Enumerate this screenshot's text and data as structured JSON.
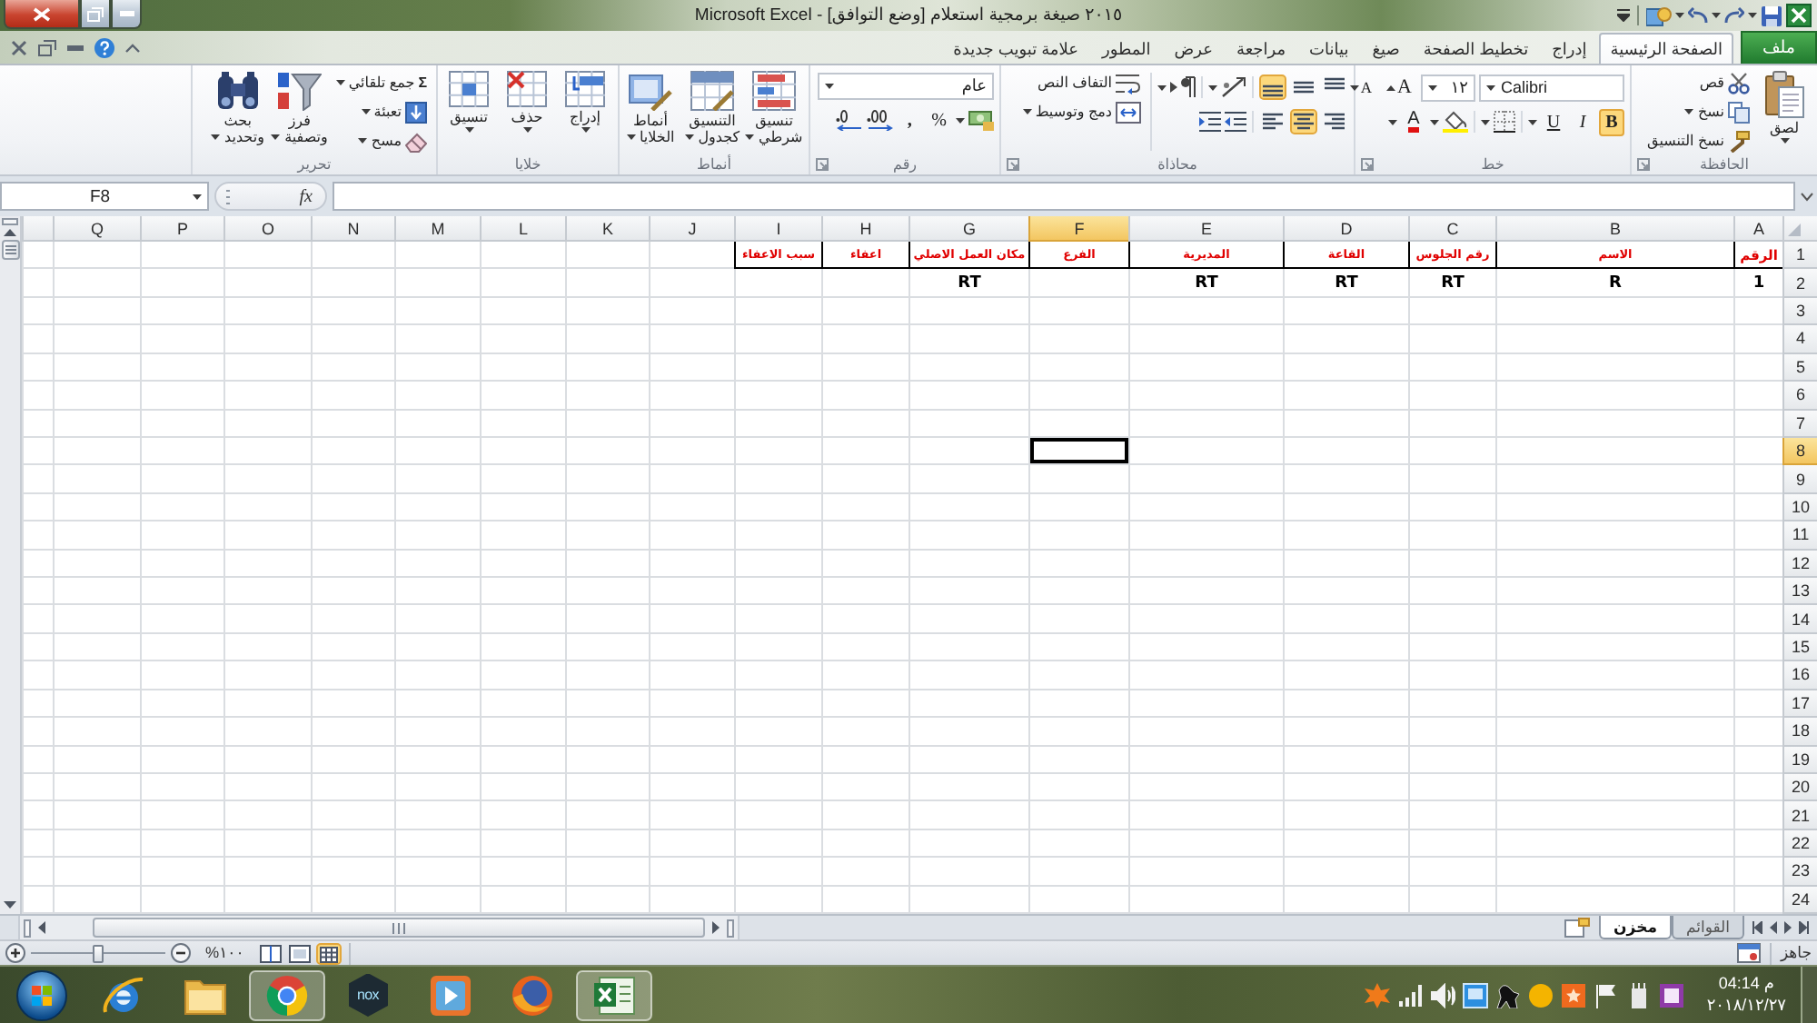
{
  "window": {
    "title": "٢٠١٥ صيغة برمجية استعلام [وضع التوافق] - Microsoft Excel"
  },
  "ribbon_tabs": [
    {
      "label": "ملف",
      "kind": "file",
      "selected": false
    },
    {
      "label": "الصفحة الرئيسية",
      "kind": "tab",
      "selected": true
    },
    {
      "label": "إدراج",
      "kind": "tab",
      "selected": false
    },
    {
      "label": "تخطيط الصفحة",
      "kind": "tab",
      "selected": false
    },
    {
      "label": "صيغ",
      "kind": "tab",
      "selected": false
    },
    {
      "label": "بيانات",
      "kind": "tab",
      "selected": false
    },
    {
      "label": "مراجعة",
      "kind": "tab",
      "selected": false
    },
    {
      "label": "عرض",
      "kind": "tab",
      "selected": false
    },
    {
      "label": "المطور",
      "kind": "tab",
      "selected": false
    },
    {
      "label": "علامة تبويب جديدة",
      "kind": "tab",
      "selected": false
    }
  ],
  "ribbon": {
    "clipboard": {
      "label": "الحافظة",
      "paste": "لصق",
      "cut": "قص",
      "copy": "نسخ",
      "format_painter": "نسخ التنسيق"
    },
    "font": {
      "label": "خط",
      "font_name": "Calibri",
      "font_size": "١٢",
      "grow": "A",
      "shrink": "A",
      "bold": {
        "text": "B",
        "on": true
      },
      "italic": {
        "text": "I",
        "on": false
      },
      "underline": {
        "text": "U",
        "on": false
      },
      "font_color": "A"
    },
    "alignment": {
      "label": "محاذاة",
      "vertical_buttons": [
        {
          "kind": "top",
          "selected": false
        },
        {
          "kind": "middle",
          "selected": false
        },
        {
          "kind": "bottom",
          "selected": true
        }
      ],
      "horizontal_buttons": [
        {
          "kind": "right",
          "selected": false
        },
        {
          "kind": "center",
          "selected": true
        },
        {
          "kind": "left",
          "selected": false
        }
      ],
      "wrap_text": "التفاف النص",
      "merge": "دمج وتوسيط"
    },
    "number": {
      "label": "رقم",
      "format": "عام",
      "percent": "%",
      "comma": ","
    },
    "styles": {
      "label": "أنماط",
      "buttons": [
        {
          "kind": "conditional",
          "label": "تنسيق شرطي"
        },
        {
          "kind": "table",
          "label": "التنسيق كجدول"
        },
        {
          "kind": "cell_styles",
          "label": "أنماط الخلايا"
        }
      ]
    },
    "cells": {
      "label": "خلايا",
      "buttons": [
        {
          "kind": "insert",
          "label": "إدراج"
        },
        {
          "kind": "delete",
          "label": "حذف"
        },
        {
          "kind": "format",
          "label": "تنسيق"
        }
      ]
    },
    "editing": {
      "label": "تحرير",
      "autosum_symbol": "Σ",
      "autosum": "جمع تلقائي",
      "fill": "تعبئة",
      "clear": "مسح",
      "sort_filter": "فرز وتصفية",
      "find_select": "بحث وتحديد"
    }
  },
  "formula_bar": {
    "name_box": "F8",
    "function_button": "fx"
  },
  "sheet": {
    "columns": [
      {
        "label": "A",
        "selected": false
      },
      {
        "label": "B",
        "selected": false
      },
      {
        "label": "C",
        "selected": false
      },
      {
        "label": "D",
        "selected": false
      },
      {
        "label": "E",
        "selected": false
      },
      {
        "label": "F",
        "selected": true
      },
      {
        "label": "G",
        "selected": false
      },
      {
        "label": "H",
        "selected": false
      },
      {
        "label": "I",
        "selected": false
      },
      {
        "label": "J",
        "selected": false
      },
      {
        "label": "K",
        "selected": false
      },
      {
        "label": "L",
        "selected": false
      },
      {
        "label": "M",
        "selected": false
      },
      {
        "label": "N",
        "selected": false
      },
      {
        "label": "O",
        "selected": false
      },
      {
        "label": "P",
        "selected": false
      },
      {
        "label": "Q",
        "selected": false
      }
    ],
    "rows": [
      {
        "label": "1",
        "kind": "heading",
        "selected": false,
        "cells": [
          "الرقم",
          "الاسم",
          "رقم الجلوس",
          "القاعة",
          "المديرية",
          "الفرع",
          "مكان العمل الاصلي",
          "اعفاء",
          "سبب الاعفاء"
        ]
      },
      {
        "label": "2",
        "kind": "data",
        "selected": false,
        "cells": [
          "1",
          "R",
          "RT",
          "RT",
          "RT",
          null,
          "RT"
        ]
      },
      {
        "label": "3",
        "kind": "blank",
        "selected": false
      },
      {
        "label": "4",
        "kind": "blank",
        "selected": false
      },
      {
        "label": "5",
        "kind": "blank",
        "selected": false
      },
      {
        "label": "6",
        "kind": "blank",
        "selected": false
      },
      {
        "label": "7",
        "kind": "blank",
        "selected": false
      },
      {
        "label": "8",
        "kind": "blank",
        "selected": true
      },
      {
        "label": "9",
        "kind": "blank",
        "selected": false
      },
      {
        "label": "10",
        "kind": "blank",
        "selected": false
      },
      {
        "label": "11",
        "kind": "blank",
        "selected": false
      },
      {
        "label": "12",
        "kind": "blank",
        "selected": false
      },
      {
        "label": "13",
        "kind": "blank",
        "selected": false
      },
      {
        "label": "14",
        "kind": "blank",
        "selected": false
      },
      {
        "label": "15",
        "kind": "blank",
        "selected": false
      },
      {
        "label": "16",
        "kind": "blank",
        "selected": false
      },
      {
        "label": "17",
        "kind": "blank",
        "selected": false
      },
      {
        "label": "18",
        "kind": "blank",
        "selected": false
      },
      {
        "label": "19",
        "kind": "blank",
        "selected": false
      },
      {
        "label": "20",
        "kind": "blank",
        "selected": false
      },
      {
        "label": "21",
        "kind": "blank",
        "selected": false
      },
      {
        "label": "22",
        "kind": "blank",
        "selected": false
      },
      {
        "label": "23",
        "kind": "blank",
        "selected": false
      },
      {
        "label": "24",
        "kind": "blank",
        "selected": false
      }
    ]
  },
  "sheet_tabs": [
    {
      "label": "القوائم",
      "selected": false
    },
    {
      "label": "مخزن",
      "selected": true
    }
  ],
  "status_bar": {
    "status": "جاهز",
    "zoom": "%١٠٠",
    "zoom_slider": {
      "level": 0.5
    },
    "views": [
      {
        "kind": "normal",
        "selected": true
      },
      {
        "kind": "page_layout",
        "selected": false
      },
      {
        "kind": "page_break",
        "selected": false
      }
    ]
  },
  "taskbar": {
    "apps": [
      {
        "kind": "e_browser",
        "highlighted": false
      },
      {
        "kind": "folder",
        "highlighted": false
      },
      {
        "kind": "ring_browser",
        "highlighted": true
      },
      {
        "kind": "hexagon",
        "label": "nox",
        "highlighted": false
      },
      {
        "kind": "player",
        "highlighted": false
      },
      {
        "kind": "fox_browser",
        "highlighted": false
      },
      {
        "kind": "spreadsheet",
        "highlighted": true
      }
    ],
    "time": "04:14 م",
    "date": "٢٠١٨/١٢/٢٧"
  }
}
